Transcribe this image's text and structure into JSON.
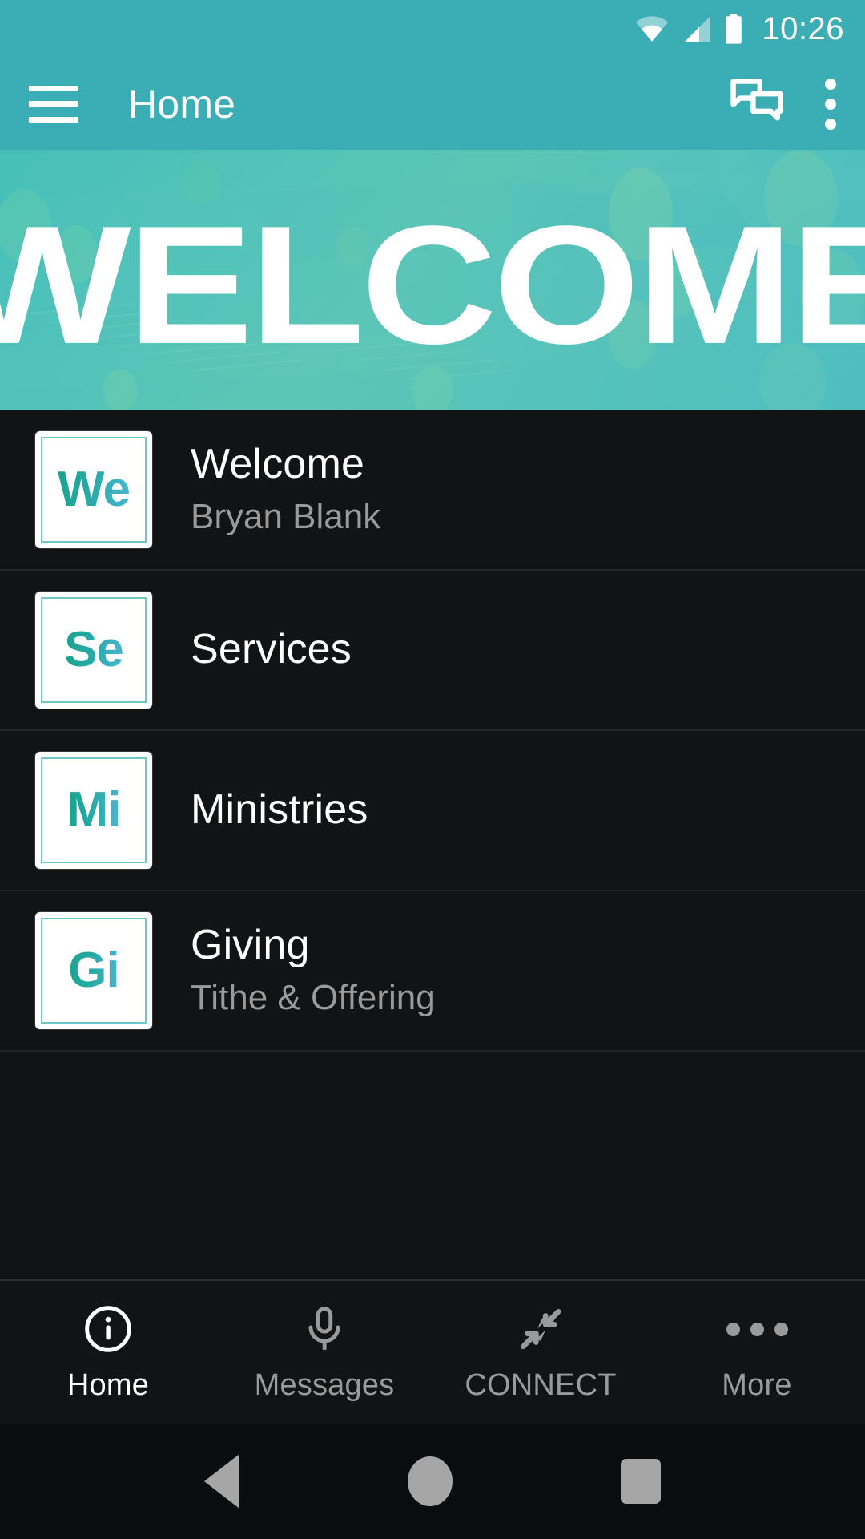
{
  "status_bar": {
    "time": "10:26",
    "icons": [
      "wifi-icon",
      "cellular-signal-icon",
      "battery-icon"
    ]
  },
  "app_bar": {
    "menu_icon": "hamburger-menu-icon",
    "title": "Home",
    "chat_icon": "chat-bubbles-icon",
    "overflow_icon": "overflow-menu-icon"
  },
  "hero": {
    "headline": "WELCOME",
    "image_description": "aerial-photo-of-church-campus",
    "tint_color": "#46bcb8"
  },
  "theme": {
    "accent": "#3aaeb4",
    "background": "#111314",
    "title_text": "#ffffff",
    "subtitle_text": "#9a9a9a",
    "thumb_border": "#6ec6c6"
  },
  "list": {
    "items": [
      {
        "thumb_text": "We",
        "title": "Welcome",
        "subtitle": "Bryan Blank"
      },
      {
        "thumb_text": "Se",
        "title": "Services",
        "subtitle": ""
      },
      {
        "thumb_text": "Mi",
        "title": "Ministries",
        "subtitle": ""
      },
      {
        "thumb_text": "Gi",
        "title": "Giving",
        "subtitle": "Tithe & Offering"
      }
    ]
  },
  "tab_bar": {
    "items": [
      {
        "label": "Home",
        "icon": "info-circle-icon",
        "active": true
      },
      {
        "label": "Messages",
        "icon": "microphone-icon",
        "active": false
      },
      {
        "label": "CONNECT",
        "icon": "collapse-arrows-icon",
        "active": false
      },
      {
        "label": "More",
        "icon": "more-dots-icon",
        "active": false
      }
    ]
  },
  "android_nav": {
    "back": "back-triangle-icon",
    "home": "home-circle-icon",
    "recents": "recents-square-icon"
  }
}
